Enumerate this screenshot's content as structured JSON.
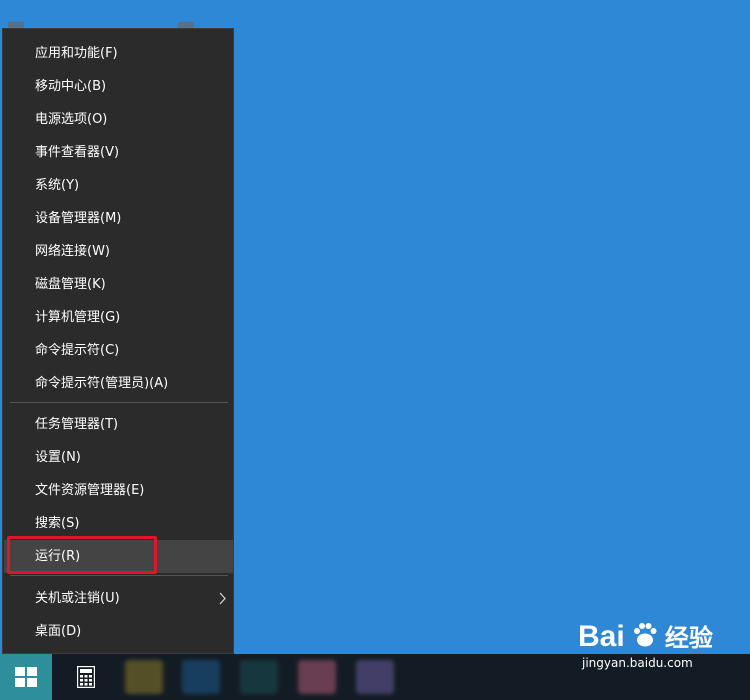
{
  "context_menu": {
    "groups": [
      [
        "应用和功能(F)",
        "移动中心(B)",
        "电源选项(O)",
        "事件查看器(V)",
        "系统(Y)",
        "设备管理器(M)",
        "网络连接(W)",
        "磁盘管理(K)",
        "计算机管理(G)",
        "命令提示符(C)",
        "命令提示符(管理员)(A)"
      ],
      [
        "任务管理器(T)",
        "设置(N)",
        "文件资源管理器(E)",
        "搜索(S)",
        "运行(R)"
      ],
      [
        "关机或注销(U)",
        "桌面(D)"
      ]
    ],
    "items": {
      "apps": "应用和功能(F)",
      "mobility": "移动中心(B)",
      "power": "电源选项(O)",
      "event_viewer": "事件查看器(V)",
      "system": "系统(Y)",
      "device_manager": "设备管理器(M)",
      "network": "网络连接(W)",
      "disk": "磁盘管理(K)",
      "computer_mgmt": "计算机管理(G)",
      "cmd": "命令提示符(C)",
      "cmd_admin": "命令提示符(管理员)(A)",
      "task_manager": "任务管理器(T)",
      "settings": "设置(N)",
      "explorer": "文件资源管理器(E)",
      "search": "搜索(S)",
      "run": "运行(R)",
      "shutdown": "关机或注销(U)",
      "desktop": "桌面(D)"
    },
    "hovered_item": "运行(R)",
    "highlighted_item": "运行(R)",
    "submenu_item": "关机或注销(U)",
    "highlight_color": "#e0152a"
  },
  "taskbar": {
    "start_icon": "windows-logo-icon",
    "pinned": [
      "calculator-icon"
    ]
  },
  "watermark": {
    "logo": "Bai",
    "logo_icon": "paw-icon",
    "logo_tail": "经验",
    "url": "jingyan.baidu.com"
  },
  "colors": {
    "desktop_bg": "#2f88d6",
    "menu_bg": "#2b2b2b",
    "taskbar_bg": "#131c24",
    "start_accent": "#2c8f9a"
  }
}
